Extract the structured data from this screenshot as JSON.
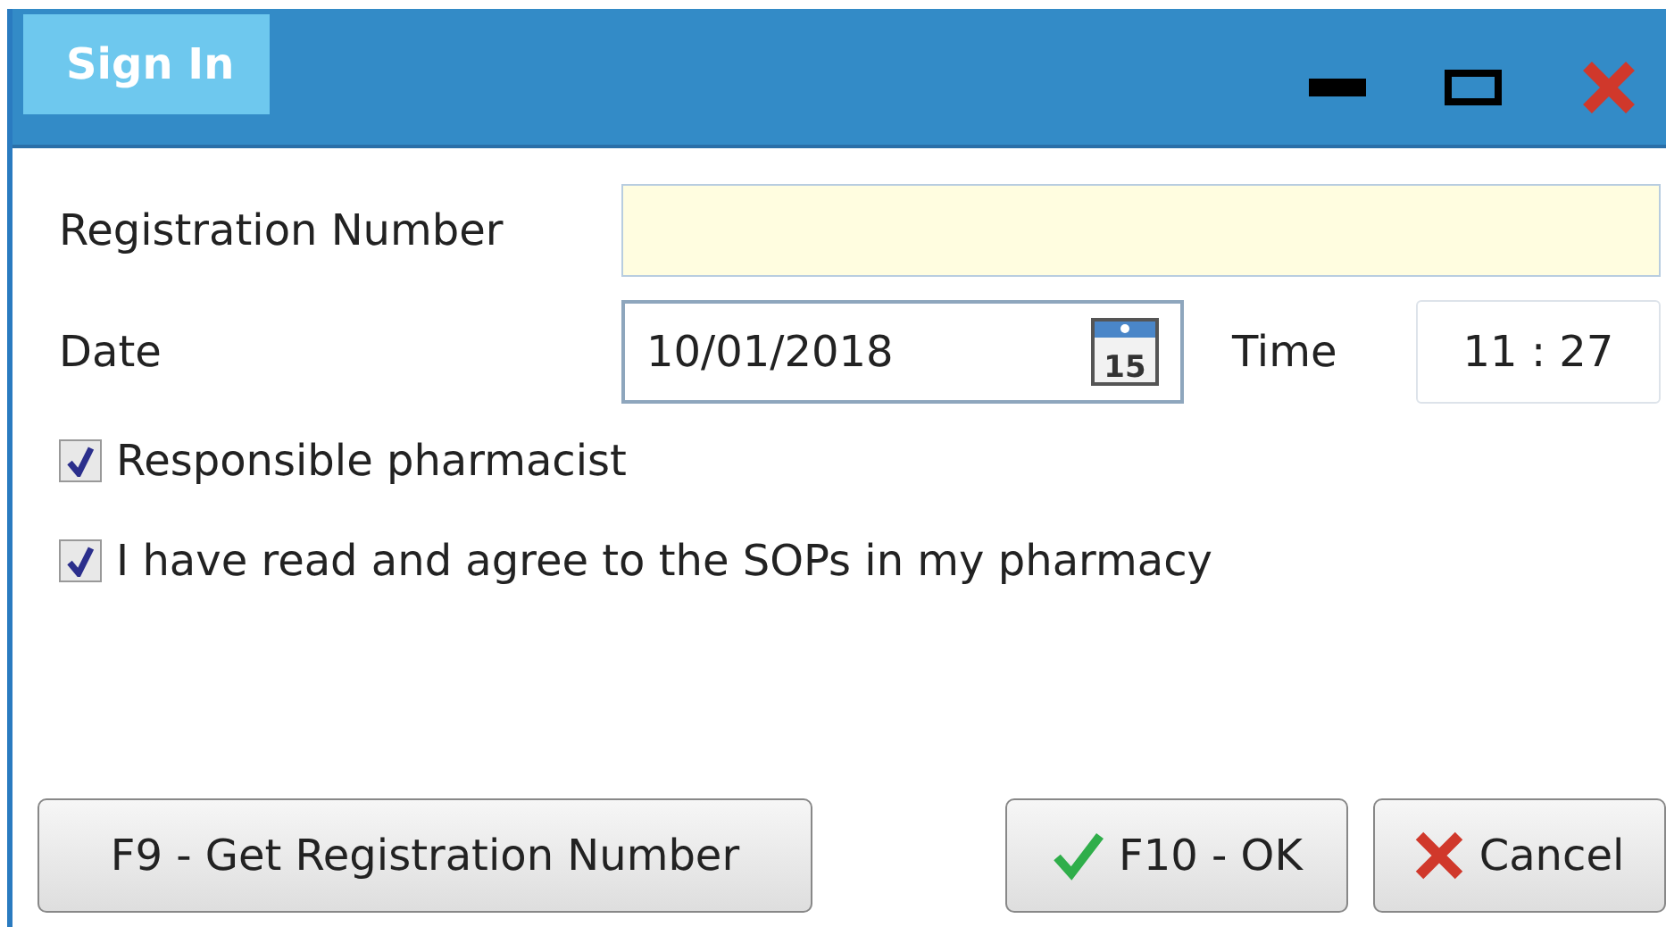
{
  "window": {
    "title": "Sign In"
  },
  "fields": {
    "registration_label": "Registration Number",
    "date_label": "Date",
    "date_value": "10/01/2018",
    "calendar_day": "15",
    "time_label": "Time",
    "time_value": "11 : 27"
  },
  "checkboxes": [
    {
      "label": "Responsible pharmacist",
      "checked": true
    },
    {
      "label": "I have read and agree to the SOPs in my pharmacy",
      "checked": true
    }
  ],
  "buttons": [
    {
      "label": "F9 - Get Registration Number",
      "kind": "plain"
    },
    {
      "label": "F10 - OK",
      "kind": "ok"
    },
    {
      "label": "Cancel",
      "kind": "cancel"
    }
  ]
}
